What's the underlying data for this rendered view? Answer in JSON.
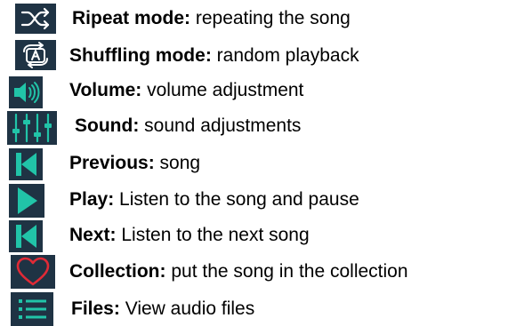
{
  "colors": {
    "icon_background": "#1f3344",
    "icon_accent": "#21c4a8",
    "heart": "#e02a36",
    "text": "#000000"
  },
  "items": [
    {
      "icon": "repeat-shuffle-icon",
      "label": "Ripeat mode:",
      "description": "  repeating the song"
    },
    {
      "icon": "shuffle-a-icon",
      "label": "Shuffling mode:",
      "description": "  random playback"
    },
    {
      "icon": "volume-icon",
      "label": "Volume:",
      "description": " volume adjustment"
    },
    {
      "icon": "equalizer-icon",
      "label": "Sound:",
      "description": " sound adjustments"
    },
    {
      "icon": "previous-icon",
      "label": "Previous:",
      "description": " song"
    },
    {
      "icon": "play-icon",
      "label": "Play:",
      "description": " Listen to the song and pause"
    },
    {
      "icon": "next-icon",
      "label": "Next:",
      "description": " Listen to the next song"
    },
    {
      "icon": "heart-icon",
      "label": "Collection:",
      "description": " put the song in the collection"
    },
    {
      "icon": "list-icon",
      "label": "Files:",
      "description": " View audio files"
    }
  ]
}
